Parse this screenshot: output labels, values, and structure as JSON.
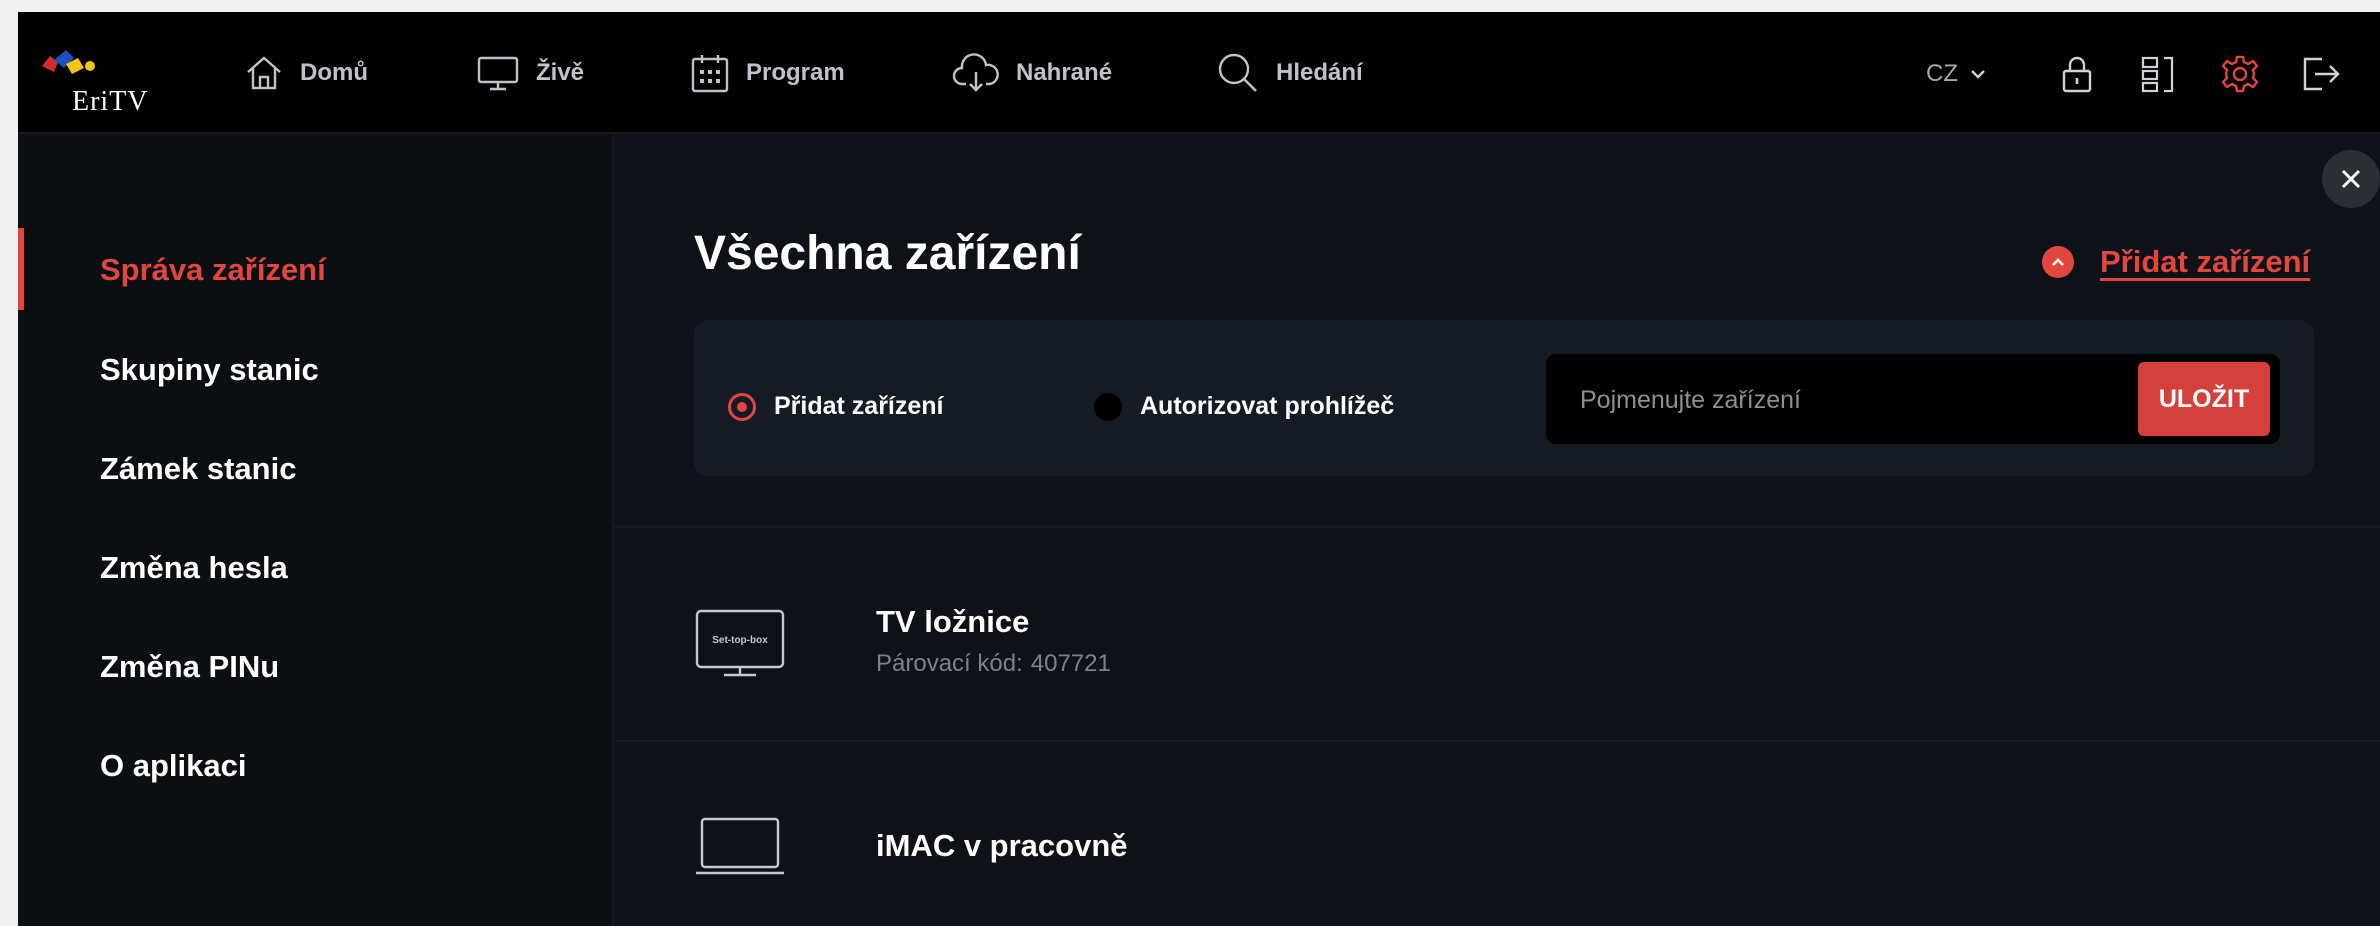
{
  "header": {
    "logo_text": "EriTV",
    "nav": [
      {
        "label": "Domů",
        "icon": "home-icon"
      },
      {
        "label": "Živě",
        "icon": "tv-icon"
      },
      {
        "label": "Program",
        "icon": "calendar-icon"
      },
      {
        "label": "Nahrané",
        "icon": "cloud-download-icon"
      },
      {
        "label": "Hledání",
        "icon": "search-icon"
      }
    ],
    "language": "CZ",
    "right_icons": [
      "lock-icon",
      "devices-icon",
      "gear-icon",
      "logout-icon"
    ],
    "active_icon_color": "#e2463f"
  },
  "sidebar": {
    "items": [
      {
        "label": "Správa zařízení",
        "active": true
      },
      {
        "label": "Skupiny stanic",
        "active": false
      },
      {
        "label": "Zámek stanic",
        "active": false
      },
      {
        "label": "Změna hesla",
        "active": false
      },
      {
        "label": "Změna PINu",
        "active": false
      },
      {
        "label": "O aplikaci",
        "active": false
      }
    ]
  },
  "main": {
    "title": "Všechna zařízení",
    "add_device_link": "Přidat zařízení",
    "form": {
      "radio_options": [
        {
          "label": "Přidat zařízení",
          "checked": true
        },
        {
          "label": "Autorizovat prohlížeč",
          "checked": false
        }
      ],
      "input_placeholder": "Pojmenujte zařízení",
      "input_value": "",
      "save_label": "ULOŽIT"
    },
    "devices": [
      {
        "name": "TV ložnice",
        "icon": "set-top-box-icon",
        "icon_label": "Set-top-box",
        "code_label": "Párovací kód:",
        "code": "407721"
      },
      {
        "name": "iMAC v pracovně",
        "icon": "laptop-icon"
      }
    ]
  },
  "colors": {
    "accent": "#e2463f",
    "background": "#0e1117",
    "panel": "#151b24",
    "topbar": "#000000"
  }
}
